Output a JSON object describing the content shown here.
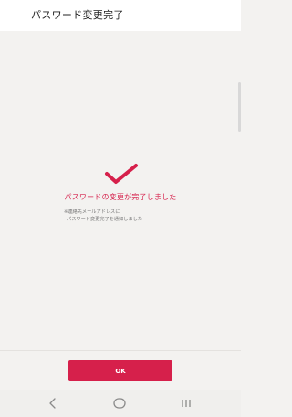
{
  "header": {
    "title": "パスワード変更完了"
  },
  "main": {
    "message": "パスワードの変更が完了しました",
    "note_line1": "※連絡先メールアドレスに",
    "note_line2": "パスワード変更完了を通知しました"
  },
  "footer": {
    "ok_label": "OK"
  },
  "navbar": {
    "back_icon": "back-icon",
    "home_icon": "home-icon",
    "recents_icon": "recents-icon"
  },
  "colors": {
    "accent": "#d6204b",
    "background": "#f3f2f0",
    "header_bg": "#ffffff"
  }
}
